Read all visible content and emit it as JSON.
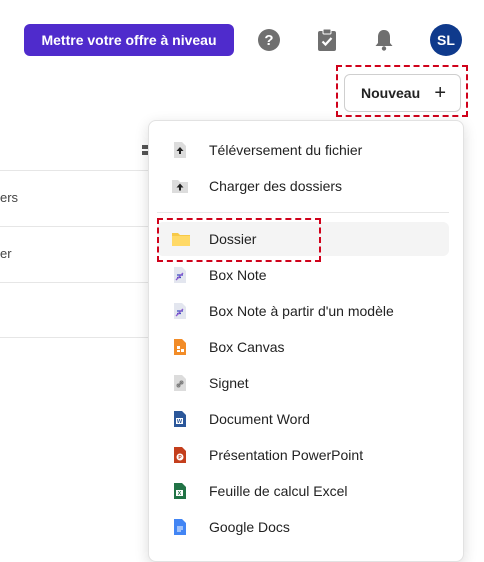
{
  "topbar": {
    "upgrade_label": "Mettre votre offre à niveau",
    "avatar_initials": "SL"
  },
  "new_button": {
    "label": "Nouveau",
    "icon": "plus-icon"
  },
  "background_rows": [
    "ers",
    "er"
  ],
  "menu": {
    "items": [
      {
        "label": "Téléversement du fichier",
        "icon": "upload-file-icon"
      },
      {
        "label": "Charger des dossiers",
        "icon": "upload-folder-icon"
      },
      {
        "label": "Dossier",
        "icon": "folder-icon"
      },
      {
        "label": "Box Note",
        "icon": "box-note-icon"
      },
      {
        "label": "Box Note à partir d'un modèle",
        "icon": "box-note-template-icon"
      },
      {
        "label": "Box Canvas",
        "icon": "box-canvas-icon"
      },
      {
        "label": "Signet",
        "icon": "bookmark-icon"
      },
      {
        "label": "Document Word",
        "icon": "word-icon"
      },
      {
        "label": "Présentation PowerPoint",
        "icon": "powerpoint-icon"
      },
      {
        "label": "Feuille de calcul Excel",
        "icon": "excel-icon"
      },
      {
        "label": "Google Docs",
        "icon": "google-docs-icon"
      }
    ]
  },
  "colors": {
    "upgrade_bg": "#4f2bcc",
    "avatar_bg": "#0f3a8c",
    "highlight": "#d0021b",
    "folder": "#f7c948",
    "word": "#2b579a",
    "powerpoint": "#c43e1c",
    "excel": "#217346",
    "google_docs": "#4285f4",
    "box_canvas": "#f28c28"
  }
}
